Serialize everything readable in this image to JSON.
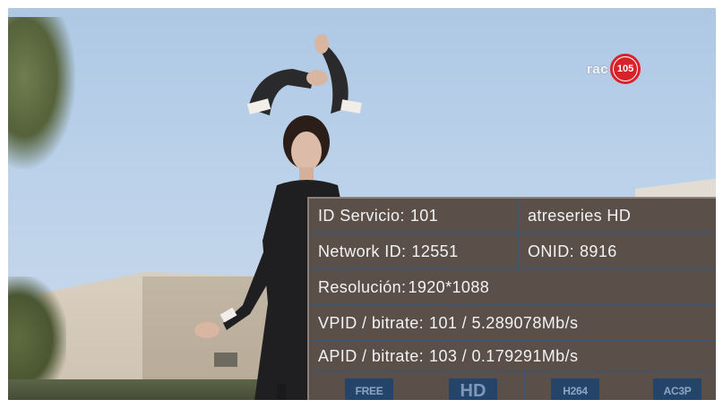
{
  "channel_logo": {
    "text": "rac",
    "badge": "105",
    "badge_color": "#d9212a"
  },
  "info_panel": {
    "service_id_label": "ID Servicio:",
    "service_id": "101",
    "channel_name": "atreseries HD",
    "network_id_label": "Network ID:",
    "network_id": "12551",
    "onid_label": "ONID:",
    "onid": "8916",
    "resolution_label": "Resolución:",
    "resolution": "1920*1088",
    "vpid_label": "VPID / bitrate:",
    "vpid": "101 / 5.289078Mb/s",
    "apid_label": "APID / bitrate:",
    "apid": "103 / 0.179291Mb/s",
    "badges": [
      "FREE",
      "HD",
      "H264",
      "AC3P"
    ]
  },
  "colors": {
    "panel_bg": "#5b4f4a",
    "grid_lines": "#40546e",
    "badge_bg": "#25446a",
    "badge_text": "#8ea4c3"
  }
}
